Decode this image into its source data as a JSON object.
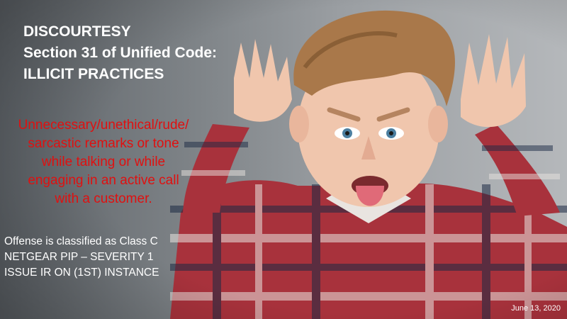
{
  "slide": {
    "title_lines": [
      "DISCOURTESY",
      "Section 31 of Unified Code:",
      "ILLICIT PRACTICES"
    ],
    "remarks_lines": [
      "Unnecessary/unethical/rude/",
      "sarcastic remarks or tone",
      "while talking or while",
      "engaging in an active call",
      "with a customer."
    ],
    "classification_lines": [
      "Offense is classified as Class C",
      "NETGEAR PIP – SEVERITY 1",
      "ISSUE IR ON (1ST) INSTANCE"
    ],
    "date": "June 13, 2020"
  },
  "colors": {
    "title": "#ffffff",
    "remarks": "#e01010",
    "classification": "#ffffff",
    "background": "#8a8e92"
  },
  "image": {
    "subject": "boy in red plaid shirt sticking tongue out with hands raised by ears"
  }
}
